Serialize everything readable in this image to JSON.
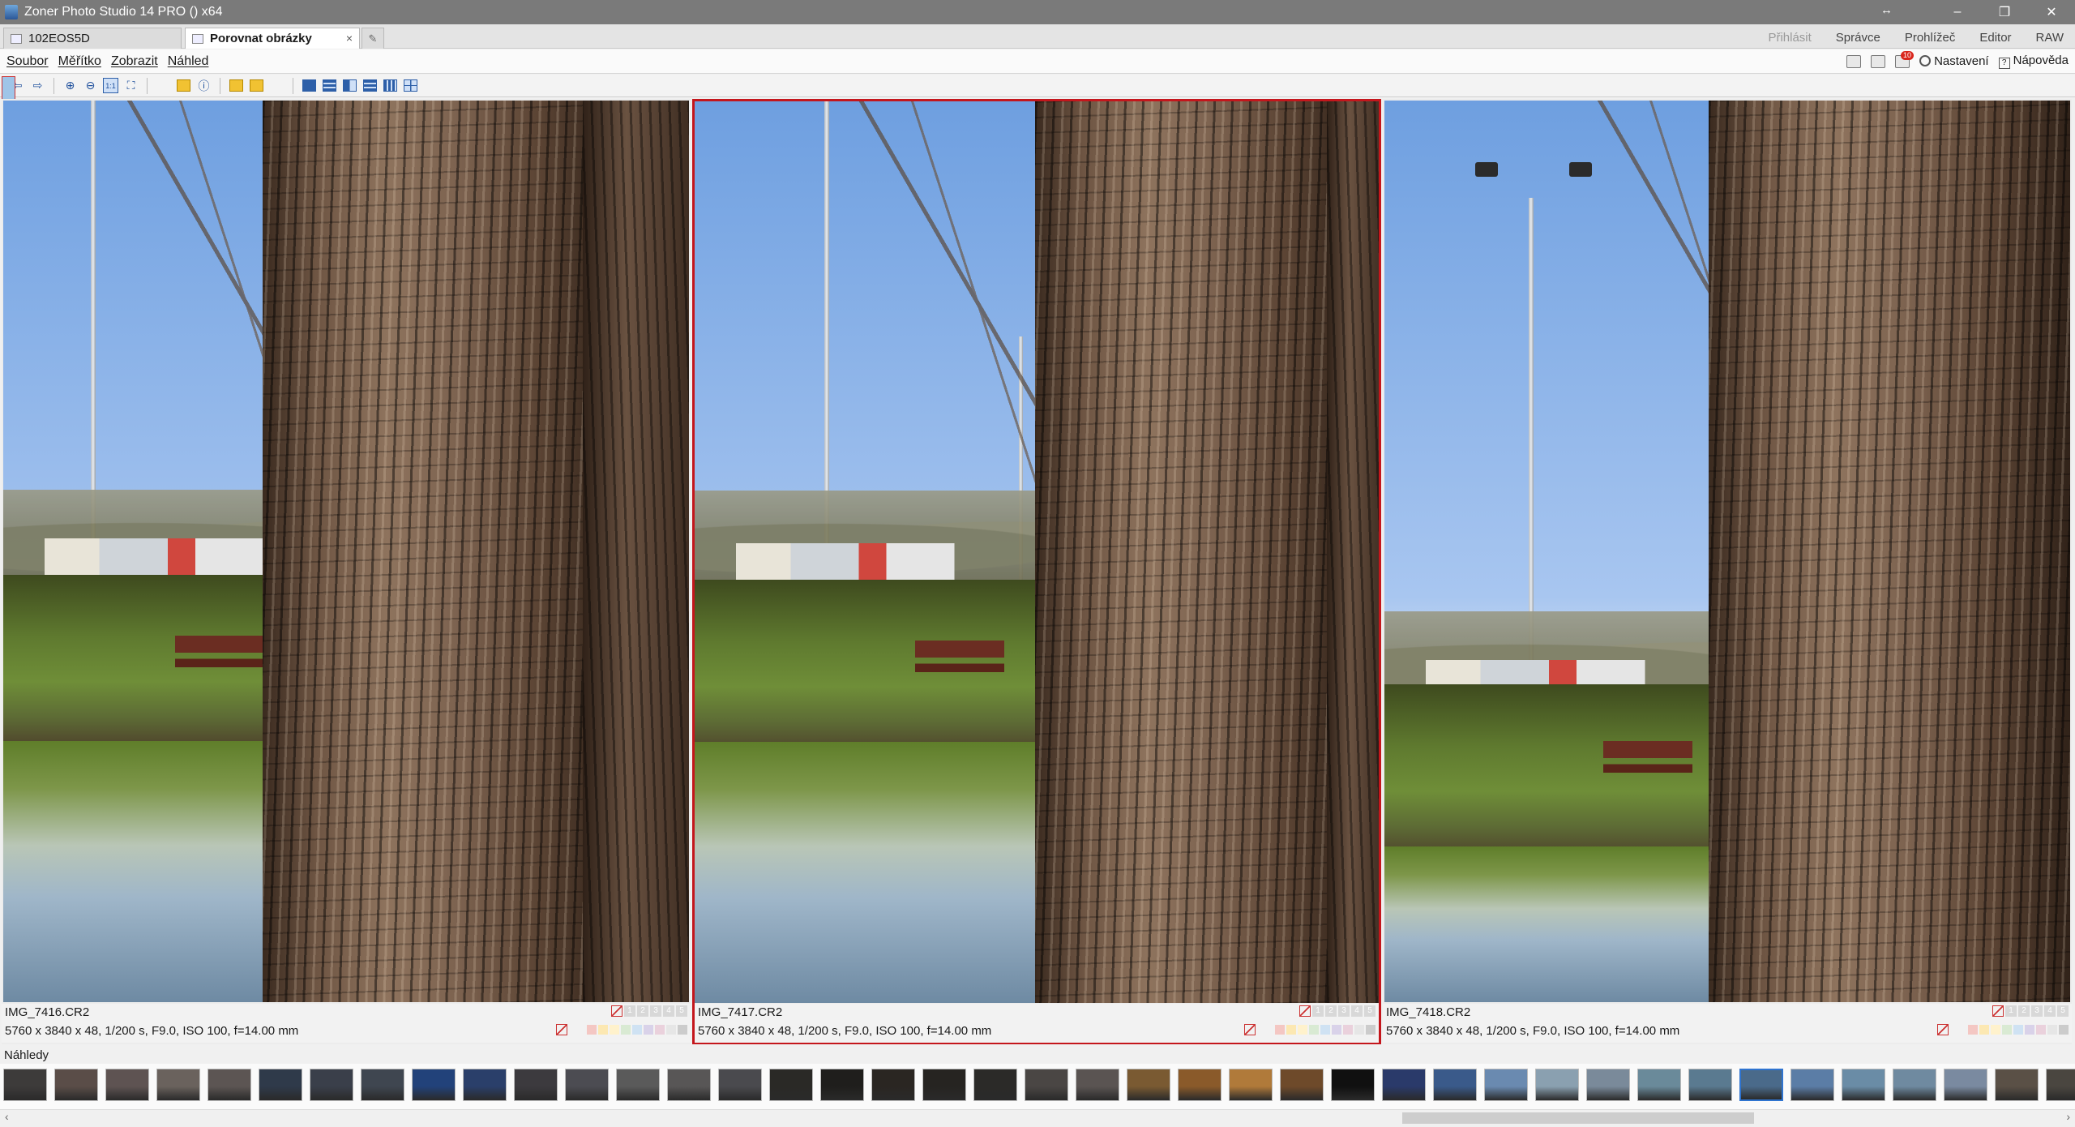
{
  "window": {
    "title": "Zoner Photo Studio 14 PRO  () x64",
    "minimize": "–",
    "restore": "❐",
    "close": "✕",
    "restore_arrows": "↔"
  },
  "tabs": [
    {
      "label": "102EOS5D",
      "active": false
    },
    {
      "label": "Porovnat obrázky",
      "active": true,
      "close": "×"
    }
  ],
  "modes": {
    "login": "Přihlásit",
    "manager": "Správce",
    "viewer": "Prohlížeč",
    "editor": "Editor",
    "raw": "RAW"
  },
  "menu": [
    "Soubor",
    "Měřítko",
    "Zobrazit",
    "Náhled"
  ],
  "menu_right": {
    "settings": "Nastavení",
    "help": "Nápověda",
    "notification_count": "10"
  },
  "toolbar": {
    "back": "⇦",
    "forward": "⇨",
    "zoom_in": "⊕",
    "zoom_out": "⊖",
    "actual_size": "1:1",
    "fit": "⛶",
    "info": "ⓘ"
  },
  "panes": [
    {
      "filename": "IMG_7416.CR2",
      "meta": "5760 x 3840 x 48, 1/200 s, F9.0, ISO 100, f=14.00 mm",
      "selected": false
    },
    {
      "filename": "IMG_7417.CR2",
      "meta": "5760 x 3840 x 48, 1/200 s, F9.0, ISO 100, f=14.00 mm",
      "selected": true
    },
    {
      "filename": "IMG_7418.CR2",
      "meta": "5760 x 3840 x 48, 1/200 s, F9.0, ISO 100, f=14.00 mm",
      "selected": false
    }
  ],
  "rating_stars": [
    "1",
    "2",
    "3",
    "4",
    "5"
  ],
  "color_labels": [
    "#f4c7c3",
    "#fce8b2",
    "#fff2cc",
    "#d9ead3",
    "#cfe2f3",
    "#d9d2e9",
    "#ead1dc",
    "#e6e6e6",
    "#cccccc"
  ],
  "thumbnails": {
    "label": "Náhledy",
    "selected_index": 34,
    "colors": [
      "#3d3b3a",
      "#5a4d48",
      "#5e5352",
      "#6a625d",
      "#5c5553",
      "#2f3a4a",
      "#3a3f4a",
      "#3f4650",
      "#22427a",
      "#2a3f6a",
      "#3c3a3e",
      "#4c4c52",
      "#5a5a5a",
      "#585656",
      "#4a4a4e",
      "#2a2926",
      "#1f1e1c",
      "#2a2622",
      "#262421",
      "#2b2a28",
      "#4a4644",
      "#5a5452",
      "#7a5a32",
      "#8a5a2a",
      "#b07a3a",
      "#6e4a2a",
      "#101010",
      "#2a3a6a",
      "#3a5a8a",
      "#6a8ab0",
      "#8aa0b0",
      "#7a8a9a",
      "#6a8a9a",
      "#5a7a90",
      "#4a6a8a",
      "#5b7da6",
      "#6a8ca6",
      "#6f8aa0",
      "#7a8aa0",
      "#5a5046",
      "#4a4640"
    ]
  },
  "scrollbar": {
    "left": "‹",
    "right": "›"
  }
}
